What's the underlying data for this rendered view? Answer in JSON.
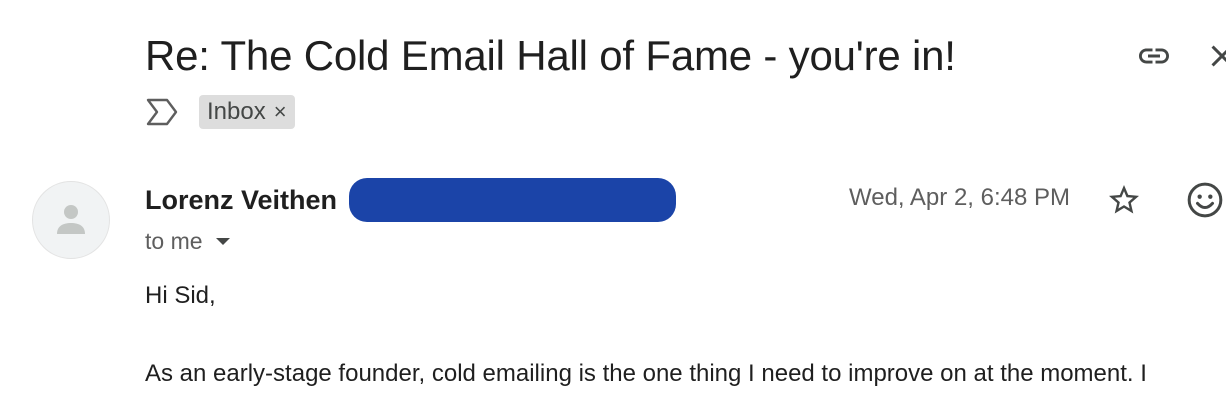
{
  "email": {
    "subject": "Re: The Cold Email Hall of Fame - you're in!",
    "labels": [
      {
        "label": "Inbox",
        "remove_glyph": "×"
      }
    ],
    "sender": {
      "name": "Lorenz Veithen",
      "email_redacted": true
    },
    "recipient_text": "to me",
    "date": "Wed, Apr 2, 6:48 PM",
    "body": {
      "greeting": "Hi Sid,",
      "paragraph_1": "As an early-stage founder, cold emailing is the one thing I need to improve on at the moment. I"
    }
  },
  "icons": {
    "header": [
      "link-icon",
      "close-icon"
    ],
    "labels": [
      "importance-marker-icon"
    ],
    "message": [
      "avatar-person-icon",
      "chevron-down-icon",
      "star-icon",
      "emoji-icon"
    ]
  },
  "colors": {
    "text_primary": "#1f1f1f",
    "text_secondary": "#5e5e5e",
    "chip_background": "#dddddd",
    "redaction_blue": "#1b44a8"
  }
}
